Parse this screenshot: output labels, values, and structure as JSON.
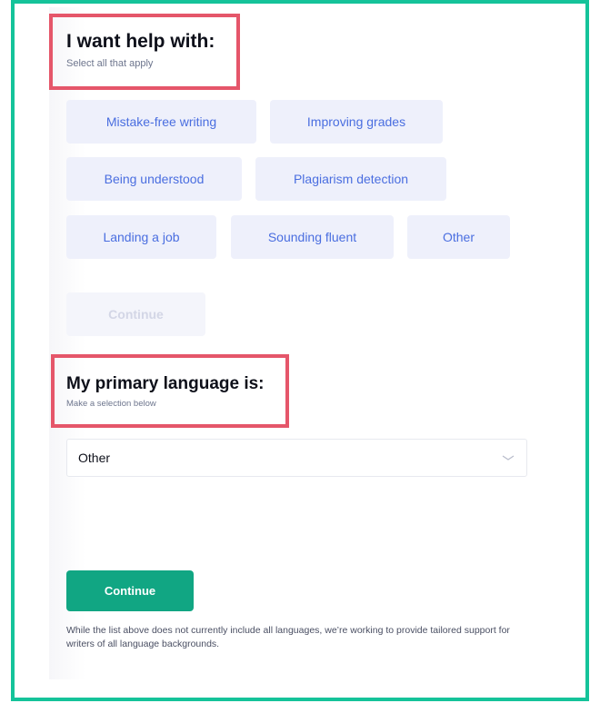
{
  "help_section": {
    "title": "I want help with:",
    "subtitle": "Select all that apply",
    "options": [
      "Mistake-free writing",
      "Improving grades",
      "Being understood",
      "Plagiarism detection",
      "Landing a job",
      "Sounding fluent",
      "Other"
    ],
    "continue_label": "Continue",
    "continue_disabled": true
  },
  "language_section": {
    "title": "My primary language is:",
    "subtitle": "Make a selection below",
    "selected_value": "Other",
    "continue_label": "Continue",
    "note": "While the list above does not currently include all languages, we’re working to provide tailored support for writers of all language backgrounds."
  },
  "colors": {
    "frame": "#15c39a",
    "highlight": "#e5566a",
    "chip_bg": "#eef0fb",
    "chip_text": "#4a6ee0",
    "primary_button": "#11a683"
  }
}
